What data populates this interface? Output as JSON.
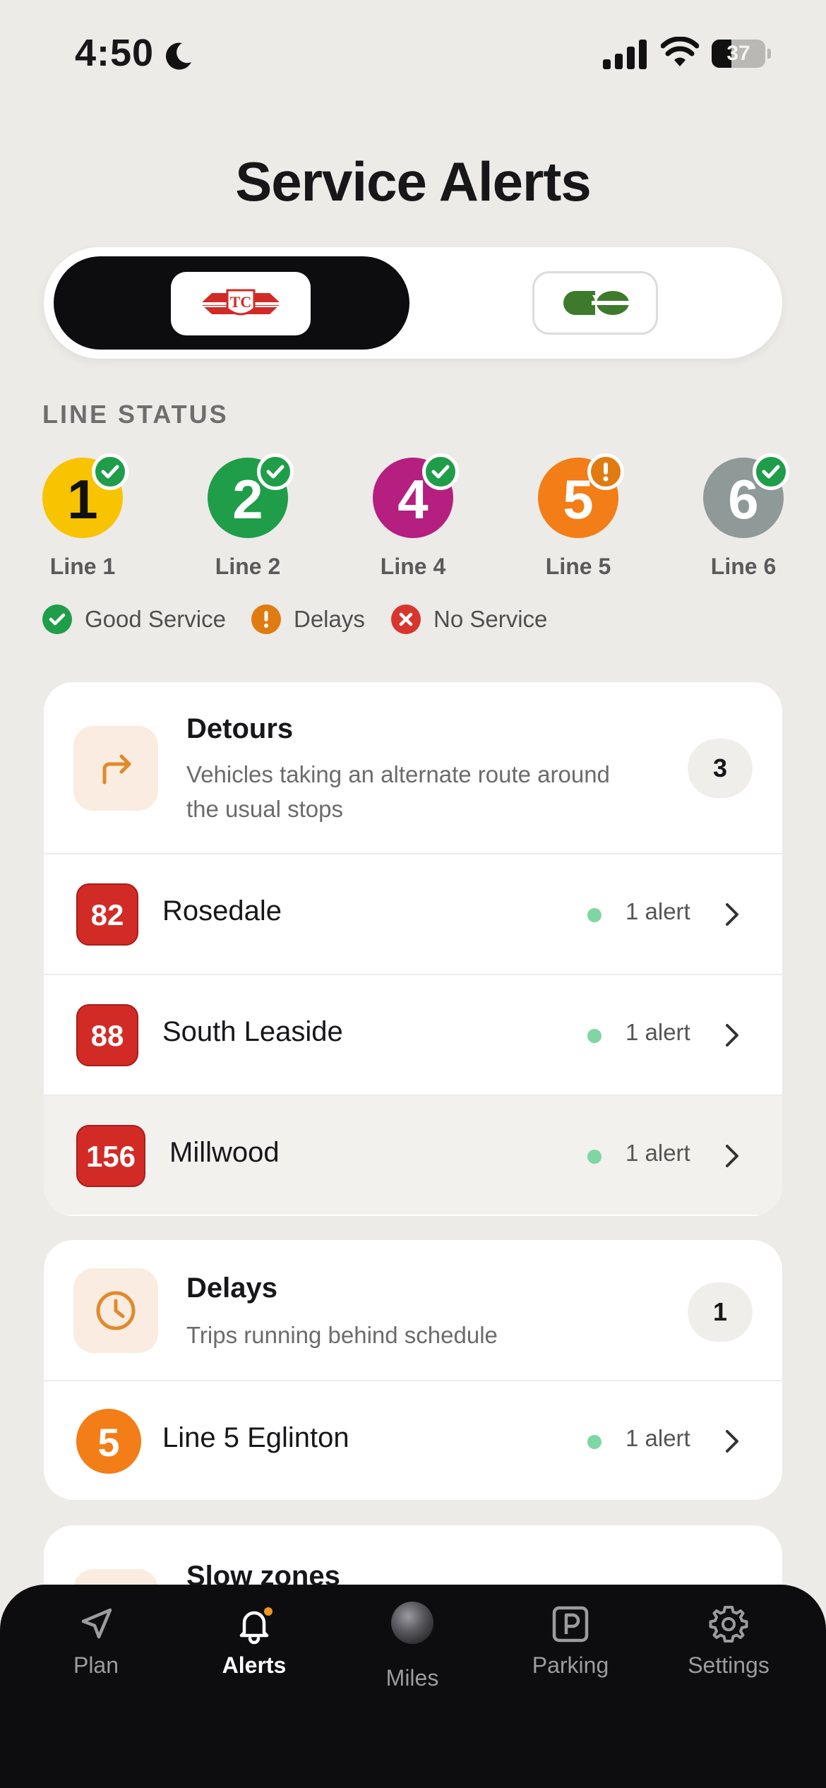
{
  "status_bar": {
    "time": "4:50",
    "battery": "37",
    "battery_level": 0.37
  },
  "page": {
    "title": "Service Alerts"
  },
  "agency_switch": {
    "selected": "TTC",
    "options": [
      "TTC",
      "GO"
    ]
  },
  "line_status": {
    "label": "LINE STATUS",
    "lines": [
      {
        "number": "1",
        "label": "Line 1",
        "color": "#f8c300",
        "text_color": "#111111",
        "status": "good"
      },
      {
        "number": "2",
        "label": "Line 2",
        "color": "#1f9d49",
        "text_color": "#ffffff",
        "status": "good"
      },
      {
        "number": "4",
        "label": "Line 4",
        "color": "#b51f80",
        "text_color": "#ffffff",
        "status": "good"
      },
      {
        "number": "5",
        "label": "Line 5",
        "color": "#f37d16",
        "text_color": "#ffffff",
        "status": "delays"
      },
      {
        "number": "6",
        "label": "Line 6",
        "color": "#8f9a98",
        "text_color": "#ffffff",
        "status": "good"
      }
    ],
    "legend": [
      {
        "label": "Good Service",
        "color": "#1f9d49"
      },
      {
        "label": "Delays",
        "color": "#e07b12"
      },
      {
        "label": "No Service",
        "color": "#d8352e"
      }
    ]
  },
  "detours": {
    "title": "Detours",
    "subtitle": "Vehicles taking an alternate route around the usual stops",
    "count": "3",
    "routes": [
      {
        "number": "82",
        "name": "Rosedale",
        "alerts": "1 alert"
      },
      {
        "number": "88",
        "name": "South Leaside",
        "alerts": "1 alert"
      },
      {
        "number": "156",
        "name": "Millwood",
        "alerts": "1 alert"
      }
    ]
  },
  "delays": {
    "title": "Delays",
    "subtitle": "Trips running behind schedule",
    "count": "1",
    "routes": [
      {
        "number": "5",
        "name": "Line 5 Eglinton",
        "alerts": "1 alert"
      }
    ]
  },
  "slow_zones": {
    "title": "Slow zones"
  },
  "tab_bar": {
    "tabs": [
      {
        "label": "Plan",
        "icon": "navigation-arrow-icon"
      },
      {
        "label": "Alerts",
        "icon": "bell-icon",
        "active": true
      },
      {
        "label": "Miles",
        "icon": "orb-icon"
      },
      {
        "label": "Parking",
        "icon": "parking-icon"
      },
      {
        "label": "Settings",
        "icon": "gear-icon"
      }
    ]
  },
  "colors": {
    "background": "#ecebe8",
    "ttc_red": "#d22b26",
    "go_green": "#3d7a2c",
    "alert_dot": "#7ed6a2",
    "detour_orange": "#e08a2c"
  }
}
